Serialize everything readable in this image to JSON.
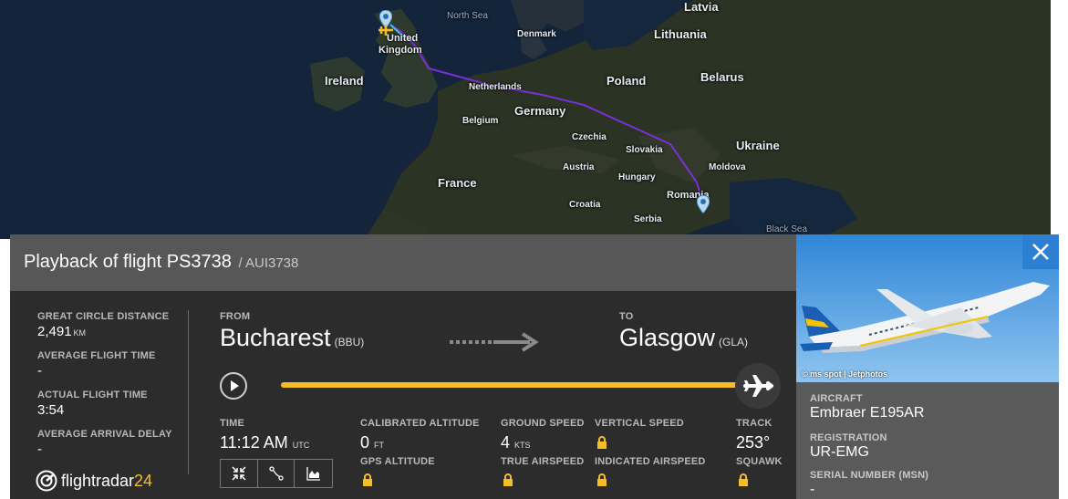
{
  "map": {
    "labels": {
      "latvia": "Latvia",
      "north_sea": "North Sea",
      "denmark": "Denmark",
      "lithuania": "Lithuania",
      "united": "United",
      "kingdom": "Kingdom",
      "ireland": "Ireland",
      "belarus": "Belarus",
      "poland": "Poland",
      "netherlands": "Netherlands",
      "germany": "Germany",
      "belgium": "Belgium",
      "czechia": "Czechia",
      "slovakia": "Slovakia",
      "ukraine": "Ukraine",
      "moldova": "Moldova",
      "austria": "Austria",
      "hungary": "Hungary",
      "france": "France",
      "romania": "Romania",
      "croatia": "Croatia",
      "serbia": "Serbia",
      "black_sea": "Black Sea"
    },
    "route_color": "#7b2fd6"
  },
  "panel": {
    "title": "Playback of flight PS3738",
    "subtitle": "/ AUI3738",
    "great_circle_distance_label": "GREAT CIRCLE DISTANCE",
    "great_circle_distance_value": "2,491",
    "great_circle_distance_unit": "KM",
    "avg_flight_time_label": "AVERAGE FLIGHT TIME",
    "avg_flight_time_value": "-",
    "actual_flight_time_label": "ACTUAL FLIGHT TIME",
    "actual_flight_time_value": "3:54",
    "avg_arrival_delay_label": "AVERAGE ARRIVAL DELAY",
    "avg_arrival_delay_value": "-",
    "from_label": "FROM",
    "from_city": "Bucharest",
    "from_code": "(BBU)",
    "to_label": "TO",
    "to_city": "Glasgow",
    "to_code": "(GLA)",
    "progress_fraction": 0.98,
    "time_label": "TIME",
    "time_value": "11:12 AM",
    "time_unit": "UTC",
    "calibrated_altitude_label": "CALIBRATED ALTITUDE",
    "calibrated_altitude_value": "0",
    "calibrated_altitude_unit": "FT",
    "gps_altitude_label": "GPS ALTITUDE",
    "ground_speed_label": "GROUND SPEED",
    "ground_speed_value": "4",
    "ground_speed_unit": "KTS",
    "true_airspeed_label": "TRUE AIRSPEED",
    "vertical_speed_label": "VERTICAL SPEED",
    "indicated_airspeed_label": "INDICATED AIRSPEED",
    "track_label": "TRACK",
    "track_value": "253°",
    "squawk_label": "SQUAWK",
    "logo_text": "flightradar",
    "logo_num": "24",
    "accent_color": "#f5be28"
  },
  "aircraft": {
    "photo_credit": "© ms spot | Jetphotos",
    "aircraft_label": "AIRCRAFT",
    "aircraft_value": "Embraer E195AR",
    "registration_label": "REGISTRATION",
    "registration_value": "UR-EMG",
    "serial_label": "SERIAL NUMBER (MSN)",
    "serial_value": "-"
  },
  "icons": {
    "close": "close-icon",
    "play": "play-icon",
    "lock": "lock-icon",
    "plane": "airplane-icon",
    "arrow": "arrow-right-icon",
    "fit": "collapse-icon",
    "route": "route-icon",
    "graph": "graph-icon"
  }
}
